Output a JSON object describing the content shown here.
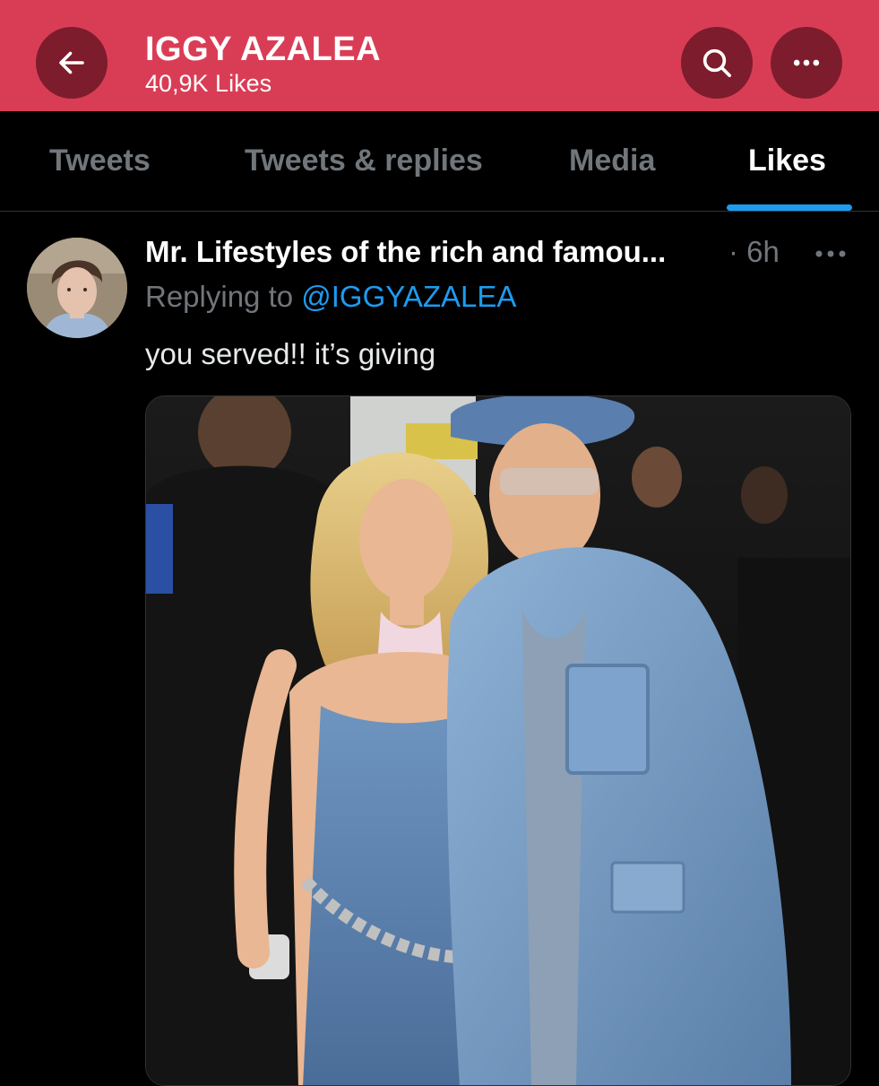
{
  "header": {
    "title": "IGGY AZALEA",
    "subtitle": "40,9K Likes",
    "back_icon": "arrow-left-icon",
    "search_icon": "search-icon",
    "more_icon": "more-horizontal-icon",
    "background_color": "#d93d55",
    "button_color": "#7d1c2c"
  },
  "tabs": [
    {
      "label": "Tweets",
      "active": false
    },
    {
      "label": "Tweets & replies",
      "active": false
    },
    {
      "label": "Media",
      "active": false
    },
    {
      "label": "Likes",
      "active": true
    }
  ],
  "tweet": {
    "author": "Mr. Lifestyles of the rich and famou...",
    "time": "· 6h",
    "replying_prefix": "Replying to ",
    "replying_handle": "@IGGYAZALEA",
    "text": "you served!! it’s giving",
    "more_icon": "more-horizontal-icon"
  },
  "colors": {
    "accent": "#1d9bf0",
    "muted_text": "#71767b",
    "background": "#000000"
  }
}
